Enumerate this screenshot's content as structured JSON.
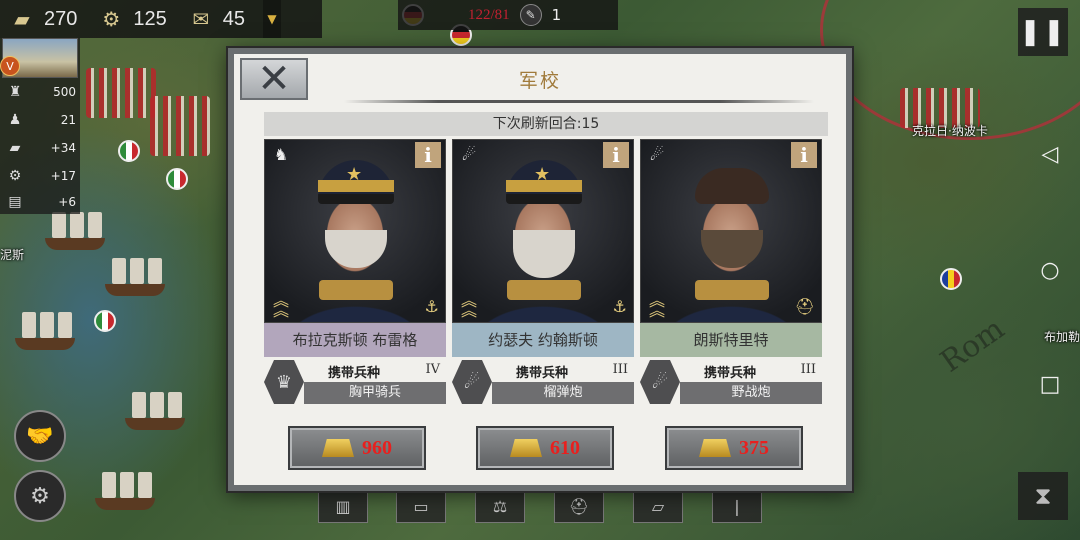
{
  "resources": {
    "gold": {
      "icon": "gold-icon",
      "value": "270"
    },
    "industry": {
      "icon": "gear-icon",
      "value": "125"
    },
    "medals": {
      "icon": "medal-icon",
      "value": "45"
    }
  },
  "turn": {
    "counter": "122/81",
    "count": "1"
  },
  "city": {
    "level": "V",
    "stats": [
      {
        "icon": "castle-icon",
        "value": "500"
      },
      {
        "icon": "population-icon",
        "value": "21"
      },
      {
        "icon": "gold-icon",
        "value": "+34"
      },
      {
        "icon": "gear-icon",
        "value": "+17"
      },
      {
        "icon": "book-icon",
        "value": "+6"
      }
    ]
  },
  "map_labels": {
    "city_label": "克拉日·纳波卡",
    "left_label": "泥斯",
    "right_label": "布加勒",
    "region": "Rom"
  },
  "dialog": {
    "title": "军校",
    "refresh_text": "下次刷新回合:15",
    "generals": [
      {
        "name": "布拉克斯顿 布雷格",
        "carry_label": "携带兵种",
        "tier": "IV",
        "unit": "胸甲骑兵",
        "price": "960",
        "class_icon": "cavalry-icon",
        "unit_icon": "cuirassier-icon"
      },
      {
        "name": "约瑟夫 约翰斯顿",
        "carry_label": "携带兵种",
        "tier": "III",
        "unit": "榴弹炮",
        "price": "610",
        "class_icon": "artillery-icon",
        "unit_icon": "howitzer-icon"
      },
      {
        "name": "朗斯特里特",
        "carry_label": "携带兵种",
        "tier": "III",
        "unit": "野战炮",
        "price": "375",
        "class_icon": "artillery-icon",
        "unit_icon": "field-gun-icon"
      }
    ]
  },
  "colors": {
    "price": "#e8201e",
    "title": "#a07a3a",
    "turn_counter": "#c02030"
  }
}
